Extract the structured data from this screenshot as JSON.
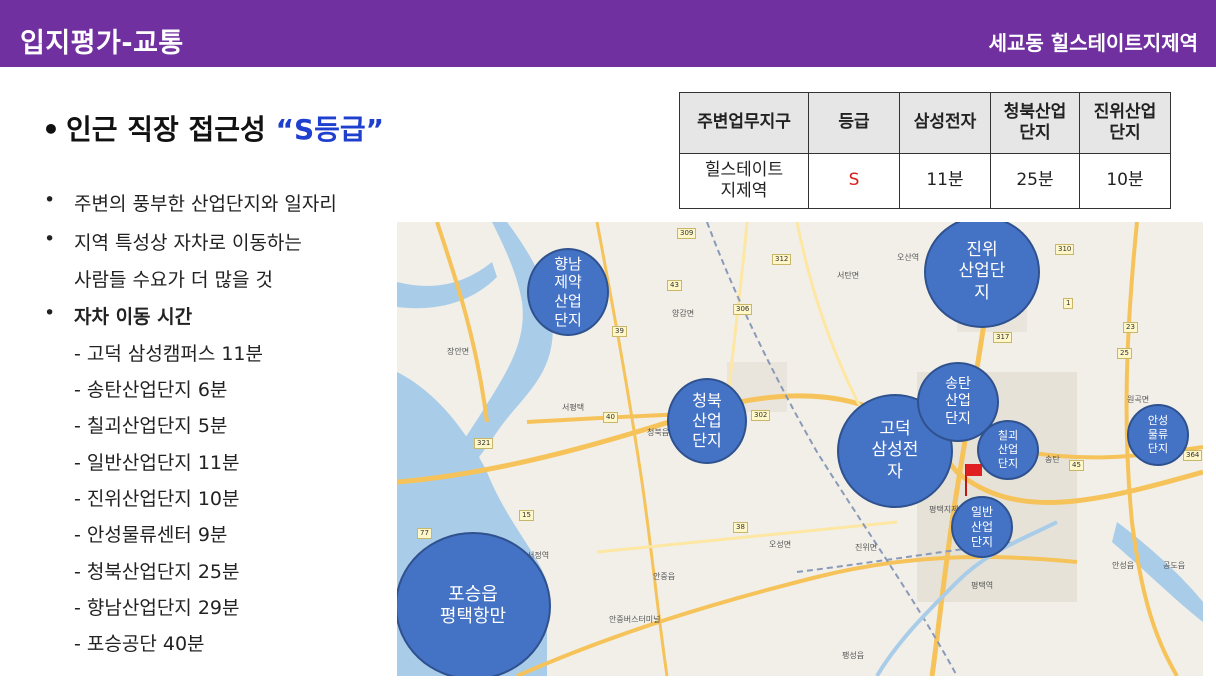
{
  "header": {
    "title": "입지평가-교통",
    "subtitle": "세교동 힐스테이트지제역"
  },
  "headline": {
    "bullet": "•",
    "text": "인근 직장 접근성 ",
    "grade": "“S등급”"
  },
  "bullets": [
    {
      "mark": "•",
      "text": "주변의 풍부한 산업단지와 일자리"
    },
    {
      "mark": "•",
      "text": "지역 특성상 자차로 이동하는"
    },
    {
      "mark": "",
      "text": "사람들 수요가 더 많을 것"
    },
    {
      "mark": "•",
      "text": "자차 이동 시간"
    }
  ],
  "travel_times": [
    "- 고덕 삼성캠퍼스  11분",
    "- 송탄산업단지  6분",
    "- 칠괴산업단지  5분",
    "- 일반산업단지  11분",
    "- 진위산업단지  10분",
    "- 안성물류센터  9분",
    "- 청북산업단지  25분",
    "- 향남산업단지  29분",
    "- 포승공단  40분"
  ],
  "table": {
    "headers": [
      "주변업무지구",
      "등급",
      "삼성전자",
      "청북산업\n단지",
      "진위산업\n단지"
    ],
    "row": [
      "힐스테이트\n지제역",
      "S",
      "11분",
      "25분",
      "10분"
    ]
  },
  "map": {
    "circles": [
      {
        "id": "hyangnam",
        "text": "향남\n제약\n산업\n단지"
      },
      {
        "id": "jinwi",
        "text": "진위\n산업단\n지"
      },
      {
        "id": "cheongbuk",
        "text": "청북\n산업\n단지"
      },
      {
        "id": "songtan",
        "text": "송탄\n산업\n단지"
      },
      {
        "id": "godeok",
        "text": "고덕\n삼성전\n자"
      },
      {
        "id": "chilgoe",
        "text": "칠괴\n산업\n단지"
      },
      {
        "id": "anseong",
        "text": "안성\n물류\n단지"
      },
      {
        "id": "ilban",
        "text": "일반\n산업\n단지"
      },
      {
        "id": "poseung",
        "text": "포승읍\n평택항만"
      }
    ],
    "places": [
      "장안면",
      "서탄면",
      "양감면",
      "서평택",
      "청북읍",
      "오성면",
      "안중읍",
      "진위면",
      "원곡면",
      "공도읍",
      "평택역",
      "안성읍",
      "팽성읍",
      "서정역",
      "송탄",
      "안중버스터미널",
      "오산역",
      "평택지제역"
    ],
    "roads": [
      "309",
      "306",
      "312",
      "317",
      "302",
      "321",
      "310",
      "43",
      "39",
      "15",
      "45",
      "40",
      "77",
      "38",
      "1",
      "23",
      "25",
      "364"
    ]
  },
  "colors": {
    "header": "#7030a0",
    "grade": "#1f3fcf",
    "circle": "#4472c4",
    "red": "#d61c1c"
  }
}
